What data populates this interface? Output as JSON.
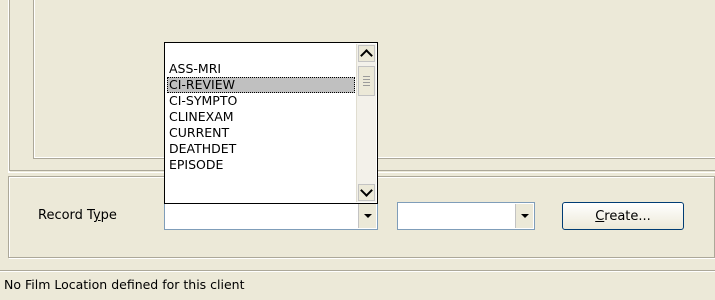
{
  "dropdown": {
    "items": [
      "ASS-MRI",
      "CI-REVIEW",
      "CI-SYMPTO",
      "CLINEXAM",
      "CURRENT",
      "DEATHDET",
      "EPISODE"
    ],
    "selected_index": 1
  },
  "form": {
    "record_type_label": "Record Type",
    "record_type_value": "",
    "secondary_value": "",
    "create_button": "Create...",
    "create_accesskey": "C"
  },
  "status": {
    "text": "No Film Location defined for this client"
  },
  "icons": {
    "scroll_up": "chevron-up-icon",
    "scroll_down": "chevron-down-icon",
    "combo_arrow": "dropdown-arrow-icon"
  }
}
